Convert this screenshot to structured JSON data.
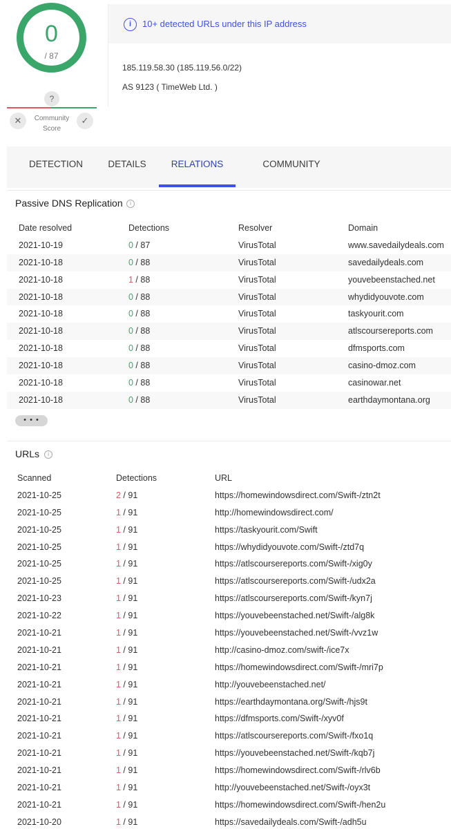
{
  "score": {
    "value": "0",
    "total": "/ 87",
    "community_unknown": "?",
    "community_label": "Community Score",
    "vote_down": "✕",
    "vote_up": "✓"
  },
  "ip_info": {
    "alert": "10+ detected URLs under this IP address",
    "ip": "185.119.58.30   (185.119.56.0/22)",
    "as": "AS 9123 ( TimeWeb Ltd. )"
  },
  "tabs": [
    {
      "label": "DETECTION"
    },
    {
      "label": "DETAILS"
    },
    {
      "label": "RELATIONS"
    },
    {
      "label": "COMMUNITY"
    }
  ],
  "passive_dns": {
    "title": "Passive DNS Replication",
    "columns": [
      "Date resolved",
      "Detections",
      "Resolver",
      "Domain"
    ],
    "rows": [
      {
        "date": "2021-10-19",
        "det": "0",
        "total": " / 87",
        "resolver": "VirusTotal",
        "domain": "www.savedailydeals.com"
      },
      {
        "date": "2021-10-18",
        "det": "0",
        "total": " / 88",
        "resolver": "VirusTotal",
        "domain": "savedailydeals.com"
      },
      {
        "date": "2021-10-18",
        "det": "1",
        "total": " / 88",
        "resolver": "VirusTotal",
        "domain": "youvebeenstached.net"
      },
      {
        "date": "2021-10-18",
        "det": "0",
        "total": " / 88",
        "resolver": "VirusTotal",
        "domain": "whydidyouvote.com"
      },
      {
        "date": "2021-10-18",
        "det": "0",
        "total": " / 88",
        "resolver": "VirusTotal",
        "domain": "taskyourit.com"
      },
      {
        "date": "2021-10-18",
        "det": "0",
        "total": " / 88",
        "resolver": "VirusTotal",
        "domain": "atlscoursereports.com"
      },
      {
        "date": "2021-10-18",
        "det": "0",
        "total": " / 88",
        "resolver": "VirusTotal",
        "domain": "dfmsports.com"
      },
      {
        "date": "2021-10-18",
        "det": "0",
        "total": " / 88",
        "resolver": "VirusTotal",
        "domain": "casino-dmoz.com"
      },
      {
        "date": "2021-10-18",
        "det": "0",
        "total": " / 88",
        "resolver": "VirusTotal",
        "domain": "casinowar.net"
      },
      {
        "date": "2021-10-18",
        "det": "0",
        "total": " / 88",
        "resolver": "VirusTotal",
        "domain": "earthdaymontana.org"
      }
    ],
    "more": "• • •"
  },
  "urls": {
    "title": "URLs",
    "columns": [
      "Scanned",
      "Detections",
      "URL"
    ],
    "rows": [
      {
        "date": "2021-10-25",
        "det": "2",
        "total": " / 91",
        "url": "https://homewindowsdirect.com/Swift-/ztn2t"
      },
      {
        "date": "2021-10-25",
        "det": "1",
        "total": " / 91",
        "url": "http://homewindowsdirect.com/"
      },
      {
        "date": "2021-10-25",
        "det": "1",
        "total": " / 91",
        "url": "https://taskyourit.com/Swift"
      },
      {
        "date": "2021-10-25",
        "det": "1",
        "total": " / 91",
        "url": "https://whydidyouvote.com/Swift-/ztd7q"
      },
      {
        "date": "2021-10-25",
        "det": "1",
        "total": " / 91",
        "url": "https://atlscoursereports.com/Swift-/xig0y"
      },
      {
        "date": "2021-10-25",
        "det": "1",
        "total": " / 91",
        "url": "https://atlscoursereports.com/Swift-/udx2a"
      },
      {
        "date": "2021-10-23",
        "det": "1",
        "total": " / 91",
        "url": "https://atlscoursereports.com/Swift-/kyn7j"
      },
      {
        "date": "2021-10-22",
        "det": "1",
        "total": " / 91",
        "url": "https://youvebeenstached.net/Swift-/alg8k"
      },
      {
        "date": "2021-10-21",
        "det": "1",
        "total": " / 91",
        "url": "https://youvebeenstached.net/Swift-/vvz1w"
      },
      {
        "date": "2021-10-21",
        "det": "1",
        "total": " / 91",
        "url": "http://casino-dmoz.com/swift-/ice7x"
      },
      {
        "date": "2021-10-21",
        "det": "1",
        "total": " / 91",
        "url": "https://homewindowsdirect.com/Swift-/mri7p"
      },
      {
        "date": "2021-10-21",
        "det": "1",
        "total": " / 91",
        "url": "http://youvebeenstached.net/"
      },
      {
        "date": "2021-10-21",
        "det": "1",
        "total": " / 91",
        "url": "https://earthdaymontana.org/Swift-/hjs9t"
      },
      {
        "date": "2021-10-21",
        "det": "1",
        "total": " / 91",
        "url": "https://dfmsports.com/Swift-/xyv0f"
      },
      {
        "date": "2021-10-21",
        "det": "1",
        "total": " / 91",
        "url": "https://atlscoursereports.com/Swift-/fxo1q"
      },
      {
        "date": "2021-10-21",
        "det": "1",
        "total": " / 91",
        "url": "https://youvebeenstached.net/Swift-/kqb7j"
      },
      {
        "date": "2021-10-21",
        "det": "1",
        "total": " / 91",
        "url": "https://homewindowsdirect.com/Swift-/rlv6b"
      },
      {
        "date": "2021-10-21",
        "det": "1",
        "total": " / 91",
        "url": "http://youvebeenstached.net/Swift-/oyx3t"
      },
      {
        "date": "2021-10-21",
        "det": "1",
        "total": " / 91",
        "url": "https://homewindowsdirect.com/Swift-/hen2u"
      },
      {
        "date": "2021-10-20",
        "det": "1",
        "total": " / 91",
        "url": "https://savedailydeals.com/Swift-/adh5u"
      }
    ]
  },
  "colors": {
    "clean": "#3aa66a",
    "malicious": "#e5555b",
    "accent": "#3f51e6"
  }
}
